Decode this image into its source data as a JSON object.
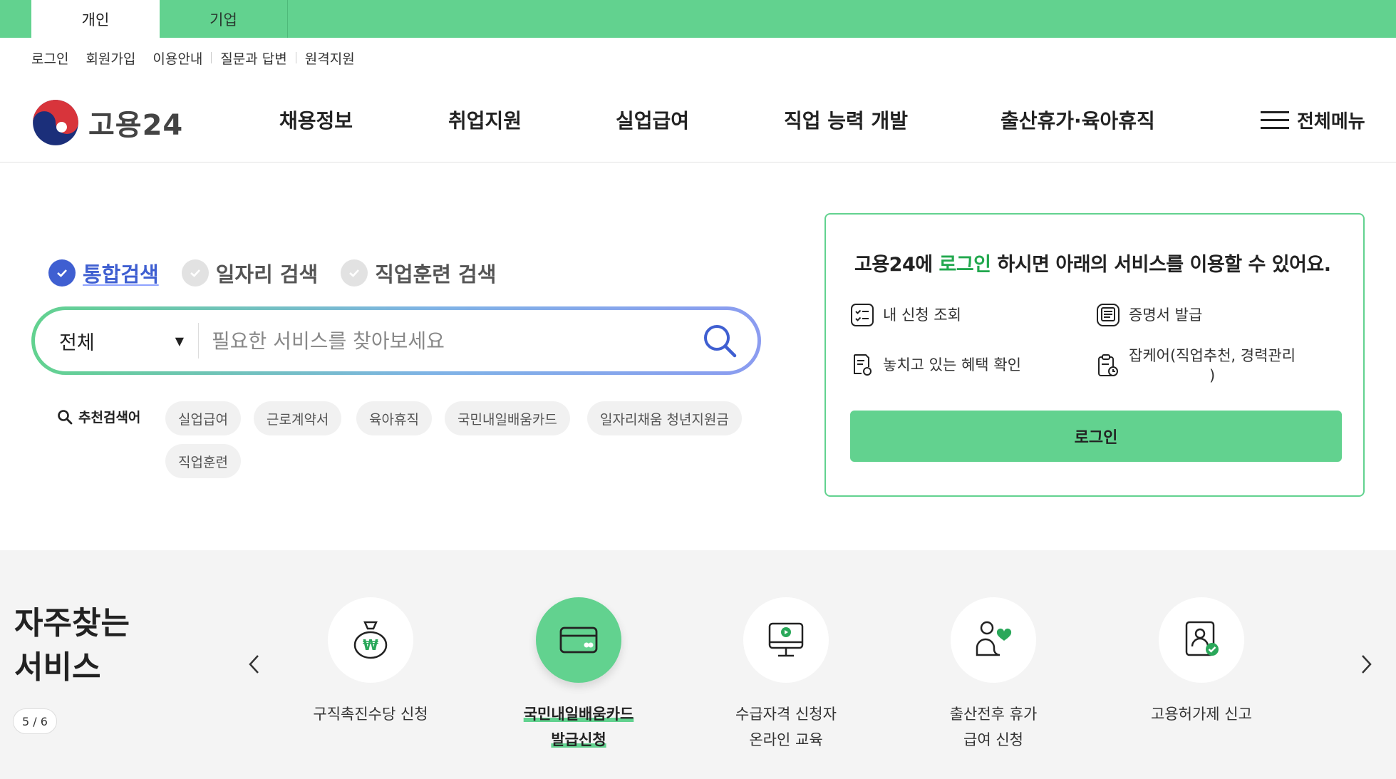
{
  "top_tabs": [
    "개인",
    "기업"
  ],
  "util_links": [
    "로그인",
    "회원가입",
    "이용안내",
    "질문과 답변",
    "원격지원"
  ],
  "logo": {
    "text": "고용24"
  },
  "gnb": [
    "채용정보",
    "취업지원",
    "실업급여",
    "직업 능력 개발",
    "출산휴가·육아휴직"
  ],
  "all_menu": "전체메뉴",
  "search": {
    "types": [
      "통합검색",
      "일자리 검색",
      "직업훈련 검색"
    ],
    "scope": "전체",
    "placeholder": "필요한 서비스를 찾아보세요",
    "reco_title": "추천검색어",
    "keywords": [
      "실업급여",
      "근로계약서",
      "육아휴직",
      "국민내일배움카드",
      "일자리채움 청년지원금",
      "직업훈련"
    ]
  },
  "login_panel": {
    "msg_pre": "고용24에 ",
    "msg_hl": "로그인",
    "msg_post": " 하시면 아래의 서비스를 이용할 수 있어요.",
    "services": [
      "내 신청 조회",
      "증명서 발급",
      "놓치고 있는 혜택 확인",
      "잡케어(직업추천, 경력관리",
      ")"
    ],
    "button": "로그인"
  },
  "frequent": {
    "heading_line1": "자주찾는",
    "heading_line2": "서비스",
    "pager": "5 / 6",
    "items": [
      {
        "line1": "구직촉진수당 신청",
        "line2": ""
      },
      {
        "line1": "국민내일배움카드",
        "line2": "발급신청"
      },
      {
        "line1": "수급자격 신청자",
        "line2": "온라인 교육"
      },
      {
        "line1": "출산전후 휴가",
        "line2": "급여 신청"
      },
      {
        "line1": "고용허가제 신고",
        "line2": ""
      }
    ]
  },
  "colors": {
    "brand_green": "#62d28f",
    "accent_blue": "#3f5fd1",
    "highlight_green": "#22a84e"
  }
}
